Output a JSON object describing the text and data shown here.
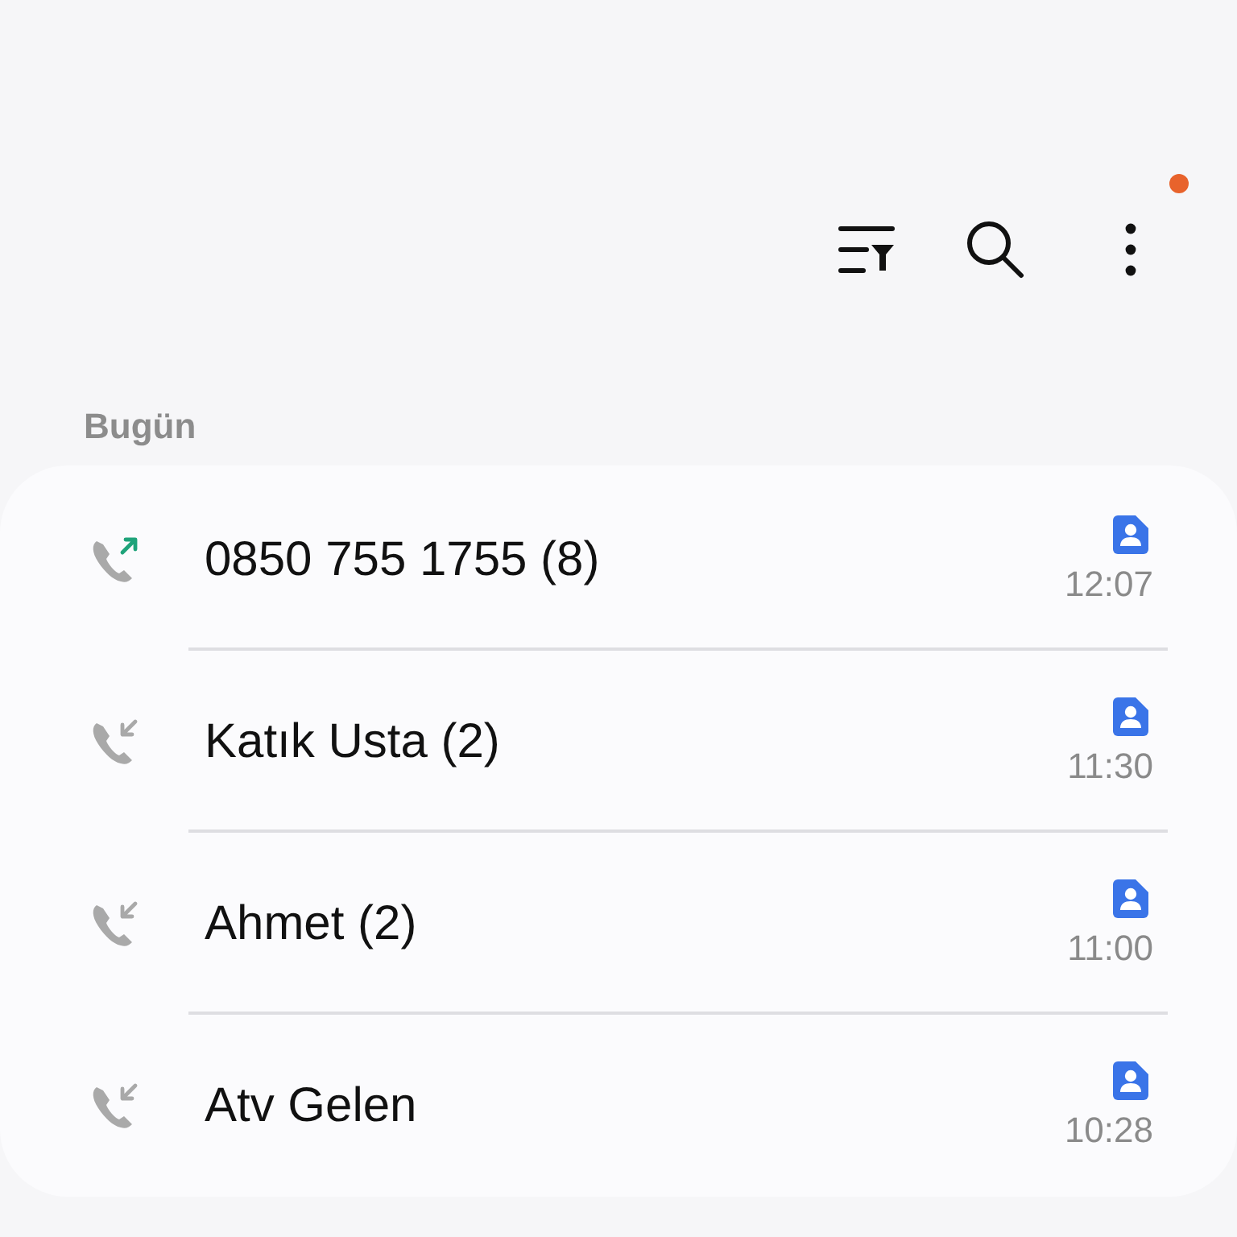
{
  "toolbar": {
    "menu_badge": true
  },
  "section": "Bugün",
  "calls": [
    {
      "kind": "outgoing",
      "name": "0850 755 1755 (8)",
      "time": "12:07"
    },
    {
      "kind": "incoming",
      "name": "Katık Usta (2)",
      "time": "11:30"
    },
    {
      "kind": "incoming",
      "name": "Ahmet (2)",
      "time": "11:00"
    },
    {
      "kind": "incoming",
      "name": "Atv Gelen",
      "time": "10:28"
    }
  ]
}
